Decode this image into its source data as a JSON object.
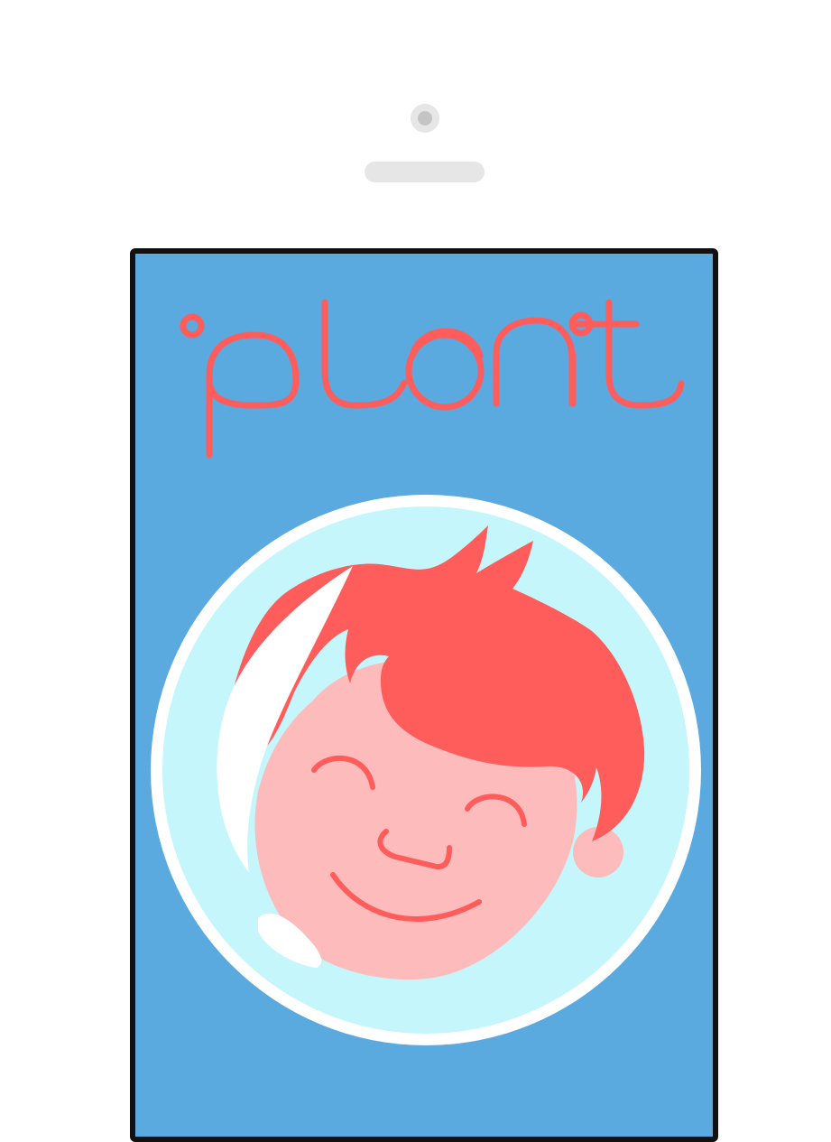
{
  "app": {
    "logo_text": "planit",
    "logo_color": "#ff5c5c"
  },
  "theme": {
    "screen_bg": "#5aaae0",
    "frame_color": "#111111",
    "avatar_ring": "#ffffff",
    "avatar_bg": "#c5f6fb",
    "hair": "#ff5c5c",
    "skin": "#fdbbbb",
    "highlight": "#ffffff"
  },
  "icons": {
    "camera": "camera-icon",
    "speaker": "speaker-icon",
    "avatar": "smiling-boy-avatar"
  }
}
